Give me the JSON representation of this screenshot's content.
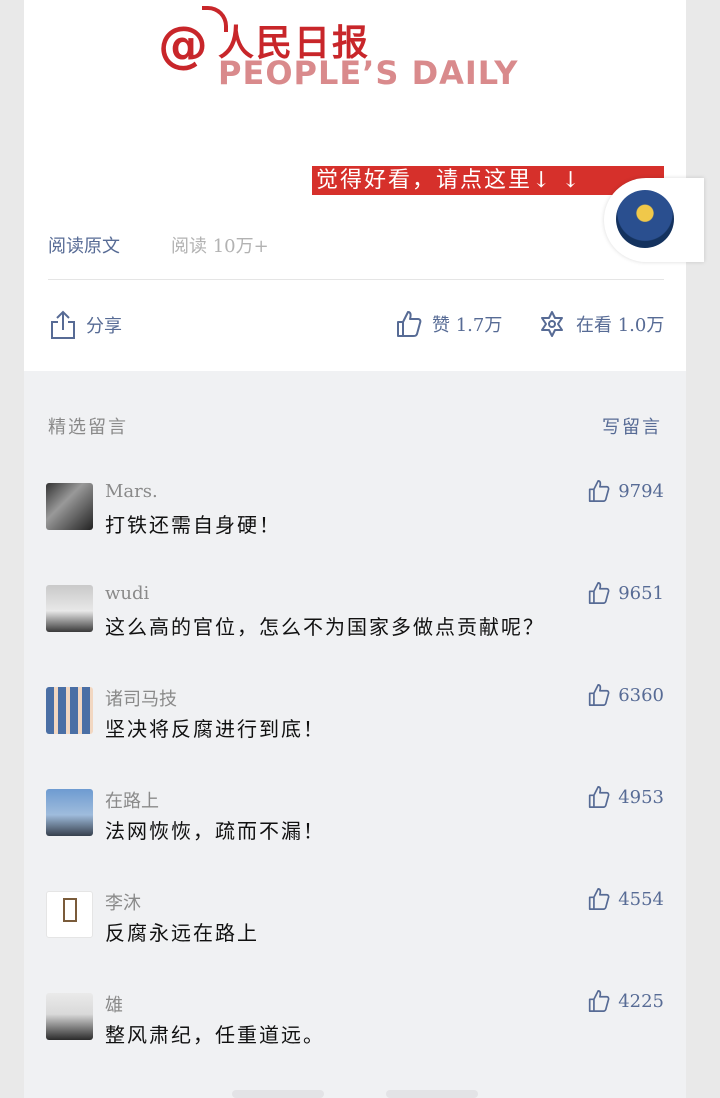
{
  "logo": {
    "at": "@",
    "name_cn": "人民日报",
    "name_en": "PEOPLE’S DAILY"
  },
  "banner": {
    "text": "觉得好看，请点这里↓ ↓"
  },
  "article_meta": {
    "read_original": "阅读原文",
    "read_count": "阅读 10万+"
  },
  "actions": {
    "share_label": "分享",
    "like_label": "赞 1.7万",
    "watch_label": "在看 1.0万"
  },
  "comments": {
    "title": "精选留言",
    "write_label": "写留言",
    "items": [
      {
        "name": "Mars.",
        "text": "打铁还需自身硬！",
        "likes": "9794"
      },
      {
        "name": "wudi",
        "text": "这么高的官位，怎么不为国家多做点贡献呢？",
        "likes": "9651"
      },
      {
        "name": "诸司马技",
        "text": "坚决将反腐进行到底！",
        "likes": "6360"
      },
      {
        "name": "在路上",
        "text": "法网恢恢，疏而不漏！",
        "likes": "4953"
      },
      {
        "name": "李沐",
        "text": "反腐永远在路上",
        "likes": "4554"
      },
      {
        "name": "雄",
        "text": "整风肃纪，任重道远。",
        "likes": "4225"
      }
    ]
  },
  "colors": {
    "brand_red": "#c8262a",
    "link_blue": "#576b95",
    "banner_red": "#d6302b"
  },
  "icons": [
    "share-icon",
    "thumb-up-icon",
    "star-icon",
    "avatar"
  ]
}
